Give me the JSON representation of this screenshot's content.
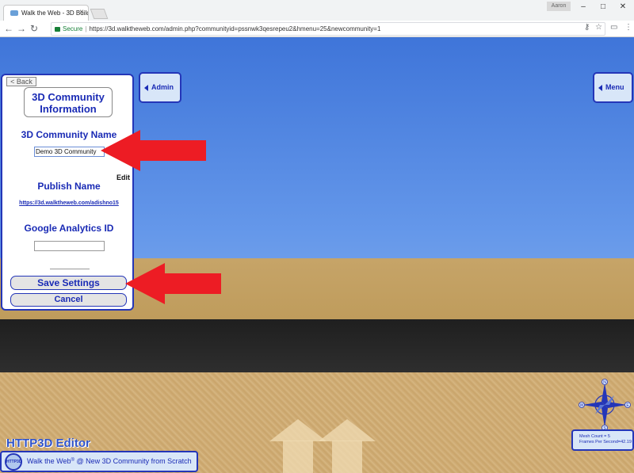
{
  "browser": {
    "tab_title": "Walk the Web - 3D Build",
    "tab_close": "×",
    "user_chip": "Aaron",
    "window_controls": [
      "–",
      "□",
      "✕"
    ],
    "nav": {
      "back": "←",
      "forward": "→",
      "reload": "↻"
    },
    "security_label": "Secure",
    "separator": "|",
    "url": "https://3d.walktheweb.com/admin.php?communityid=pssnwk3qesrepeu2&hmenu=25&newcommunity=1",
    "toolbar_icons": [
      "key-icon",
      "star-icon",
      "extension-icon",
      "menu-icon"
    ]
  },
  "panel": {
    "back_label": "< Back",
    "title_line1": "3D Community",
    "title_line2": "Information",
    "community_name_label": "3D Community Name",
    "community_name_value": "Demo 3D Community",
    "edit_label": "Edit",
    "publish_name_label": "Publish Name",
    "publish_url": "https://3d.walktheweb.com/adishno15",
    "ga_label": "Google Analytics ID",
    "ga_value": "",
    "save_label": "Save Settings",
    "cancel_label": "Cancel"
  },
  "overlay": {
    "admin_label": "Admin",
    "menu_label": "Menu"
  },
  "footer": {
    "editor_title": "HTTP3D Editor",
    "logo_text": "HTTP3D",
    "brand": "Walk the Web",
    "registered": "®",
    "location": " @ New 3D Community from Scratch"
  },
  "stats": {
    "mesh_count": "Mesh Count = 5",
    "fps": "Frames Per Second=42.19"
  },
  "compass": {
    "n": "N",
    "e": "E",
    "s": "S",
    "w": "W"
  },
  "colors": {
    "accent_blue": "#2436b8",
    "sky": "#4c82e0",
    "ground": "#c6a468",
    "road": "#262626",
    "arrow_red": "#ed1c24"
  }
}
